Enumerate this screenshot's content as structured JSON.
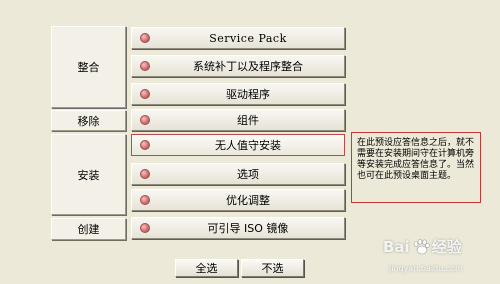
{
  "groups": [
    {
      "id": "integrate",
      "label": "整合"
    },
    {
      "id": "remove",
      "label": "移除"
    },
    {
      "id": "install",
      "label": "安装"
    },
    {
      "id": "create",
      "label": "创建"
    }
  ],
  "rows": [
    {
      "label": "Service Pack"
    },
    {
      "label": "系统补丁以及程序整合"
    },
    {
      "label": "驱动程序"
    },
    {
      "label": "组件"
    },
    {
      "label": "无人值守安装"
    },
    {
      "label": "选项"
    },
    {
      "label": "优化调整"
    },
    {
      "label": "可引导 ISO 镜像"
    }
  ],
  "selected_row": "无人值守安装",
  "info_text": "在此预设应答信息之后，就不需要在安装期间守在计算机旁等安装完成应答信息了。当然也可在此预设桌面主题。",
  "buttons": {
    "select_all": "全选",
    "select_none": "不选"
  },
  "watermark": {
    "brand_left": "Bai",
    "brand_right": "经验",
    "url": "jingyan.baidu.com"
  },
  "colors": {
    "background": "#ece9d8",
    "highlight_border": "#c03a3a",
    "indicator_dot": "#d46a6a"
  }
}
